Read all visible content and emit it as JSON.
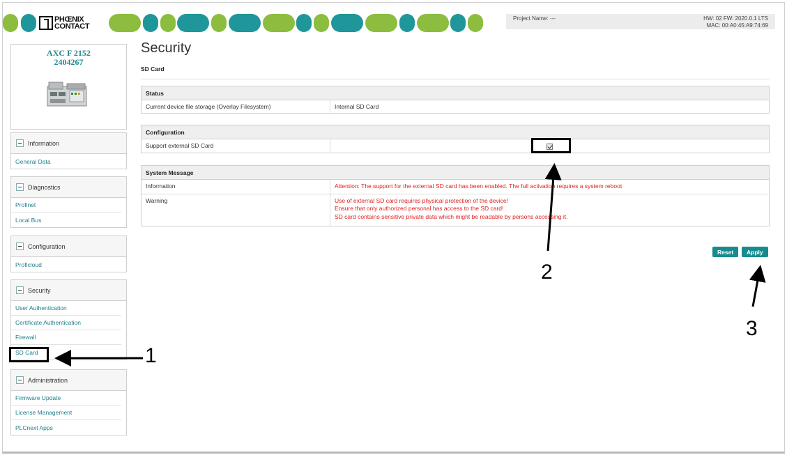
{
  "header": {
    "logo_line1": "PHŒNIX",
    "logo_line2": "CONTACT",
    "project_name": "Project Name: ---",
    "hw_fw": "HW: 02 FW: 2020.0.1 LTS",
    "mac": "MAC: 00:A0:45:A9:74:69",
    "banner_colors": {
      "green": "#8cbd3f",
      "teal": "#1f969a"
    }
  },
  "sidebar": {
    "device_model": "AXC F 2152",
    "device_number": "2404267",
    "groups": [
      {
        "label": "Information",
        "items": [
          "General Data"
        ]
      },
      {
        "label": "Diagnostics",
        "items": [
          "Profinet",
          "Local Bus"
        ]
      },
      {
        "label": "Configuration",
        "items": [
          "Proficloud"
        ]
      },
      {
        "label": "Security",
        "items": [
          "User Authentication",
          "Certificate Authentication",
          "Firewall",
          "SD Card"
        ]
      },
      {
        "label": "Administration",
        "items": [
          "Firmware Update",
          "License Management",
          "PLCnext Apps"
        ]
      }
    ]
  },
  "main": {
    "title": "Security",
    "subtitle": "SD Card",
    "status": {
      "heading": "Status",
      "label": "Current device file storage (Overlay Filesystem)",
      "value": "Internal SD Card"
    },
    "configuration": {
      "heading": "Configuration",
      "label": "Support external SD Card",
      "checked": true
    },
    "system_message": {
      "heading": "System Message",
      "info_label": "Information",
      "info_text": "Attention: The support for the external SD card has been enabled. The full activation requires a system reboot",
      "warning_label": "Warning",
      "warning_lines": [
        "Use of external SD card requires physical protection of the device!",
        "Ensure that only authorized personal has access to the SD card!",
        "SD card contains sensitive private data which might be readable by persons accessing it."
      ]
    },
    "buttons": {
      "reset": "Reset",
      "apply": "Apply"
    }
  },
  "annotations": {
    "n1": "1",
    "n2": "2",
    "n3": "3"
  },
  "colors": {
    "accent": "#178c8f",
    "link": "#1f7f8c",
    "warning": "#e02020"
  }
}
